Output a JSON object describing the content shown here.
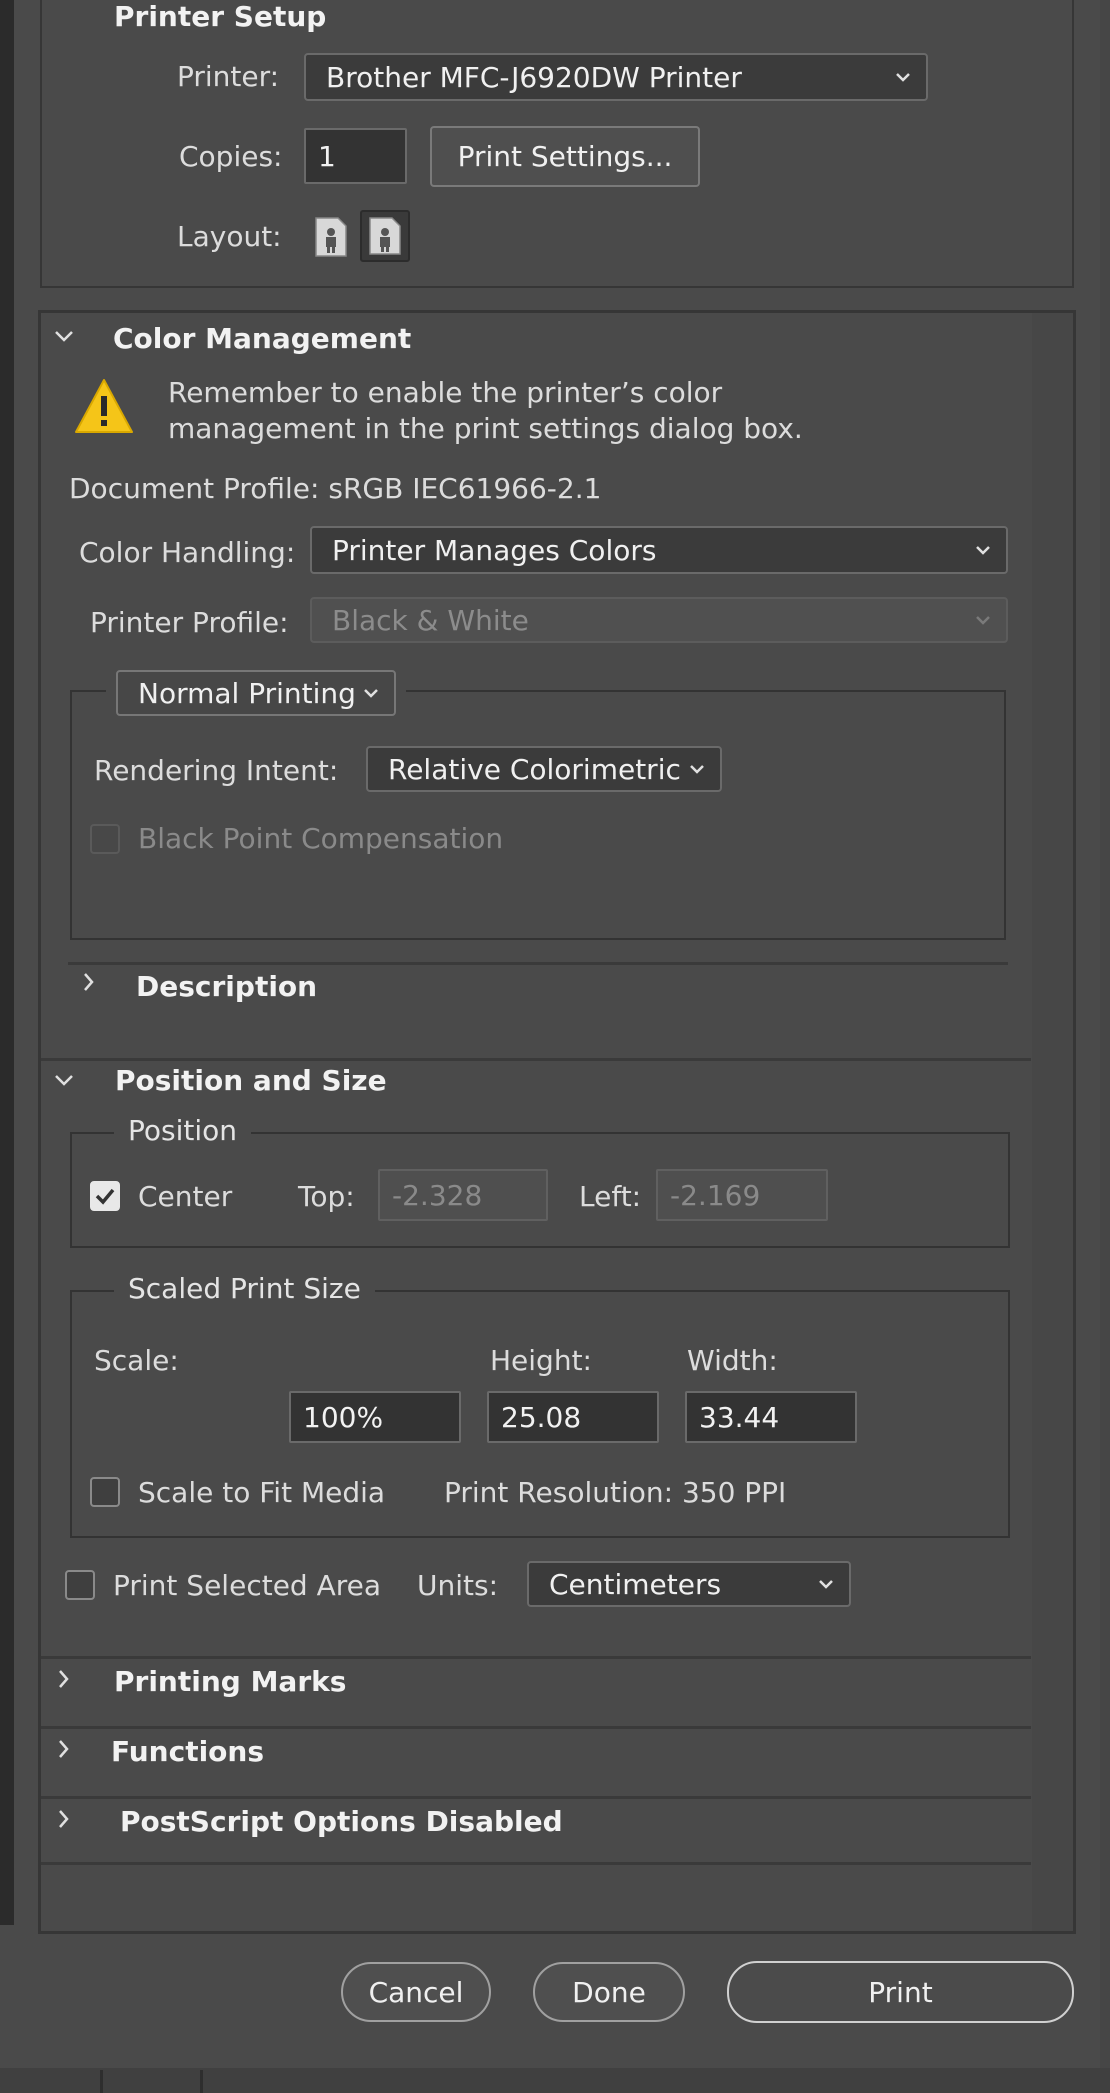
{
  "printer_setup": {
    "title": "Printer Setup",
    "printer_label": "Printer:",
    "printer_value": "Brother MFC-J6920DW Printer",
    "copies_label": "Copies:",
    "copies_value": "1",
    "print_settings_button": "Print Settings...",
    "layout_label": "Layout:"
  },
  "color_management": {
    "title": "Color Management",
    "warning_line1": "Remember to enable the printer’s color",
    "warning_line2": "management in the print settings dialog box.",
    "document_profile": "Document Profile: sRGB IEC61966-2.1",
    "color_handling_label": "Color Handling:",
    "color_handling_value": "Printer Manages Colors",
    "printer_profile_label": "Printer Profile:",
    "printer_profile_value": "Black & White",
    "printing_mode": "Normal Printing",
    "rendering_intent_label": "Rendering Intent:",
    "rendering_intent_value": "Relative Colorimetric",
    "black_point_label": "Black Point Compensation",
    "description_title": "Description"
  },
  "position_size": {
    "title": "Position and Size",
    "position_group": "Position",
    "center_label": "Center",
    "top_label": "Top:",
    "top_value": "-2.328",
    "left_label": "Left:",
    "left_value": "-2.169",
    "scaled_group": "Scaled Print Size",
    "scale_label": "Scale:",
    "height_label": "Height:",
    "width_label": "Width:",
    "scale_value": "100%",
    "height_value": "25.08",
    "width_value": "33.44",
    "scale_to_fit_label": "Scale to Fit Media",
    "print_resolution": "Print Resolution: 350 PPI",
    "print_selected_label": "Print Selected Area",
    "units_label": "Units:",
    "units_value": "Centimeters"
  },
  "sections": {
    "printing_marks": "Printing Marks",
    "functions": "Functions",
    "postscript": "PostScript Options Disabled"
  },
  "footer": {
    "cancel": "Cancel",
    "done": "Done",
    "print": "Print"
  },
  "colors": {
    "background": "#4a4a4a",
    "panel_border": "#363636",
    "warning_yellow": "#f5c518"
  }
}
